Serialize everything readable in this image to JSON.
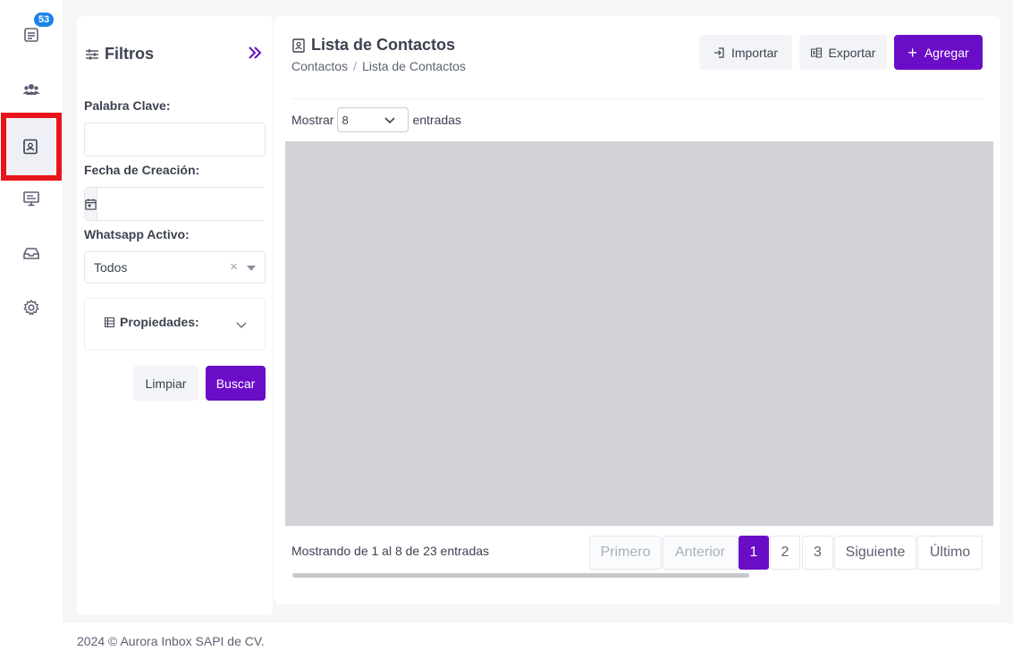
{
  "sidebar": {
    "badge_count": "53",
    "items": [
      {
        "name": "tickets",
        "icon": "ticket-icon"
      },
      {
        "name": "users",
        "icon": "users-icon"
      },
      {
        "name": "contacts",
        "icon": "contact-book-icon",
        "active": true
      },
      {
        "name": "monitor",
        "icon": "monitor-icon"
      },
      {
        "name": "inbox",
        "icon": "inbox-tray-icon"
      },
      {
        "name": "settings",
        "icon": "gear-icon"
      }
    ]
  },
  "filters": {
    "title": "Filtros",
    "keyword_label": "Palabra Clave:",
    "keyword_value": "",
    "date_label": "Fecha de Creación:",
    "date_value": "",
    "whatsapp_label": "Whatsapp Activo:",
    "whatsapp_value": "Todos",
    "clear_symbol": "×",
    "properties_label": "Propiedades:",
    "clear_button": "Limpiar",
    "search_button": "Buscar"
  },
  "header": {
    "title": "Lista de Contactos",
    "breadcrumb": [
      "Contactos",
      "Lista de Contactos"
    ],
    "breadcrumb_sep": "/",
    "import_button": "Importar",
    "export_button": "Exportar",
    "add_button": "Agregar",
    "add_symbol": "+"
  },
  "table": {
    "show_label": "Mostrar",
    "entries_value": "8",
    "entries_label": "entradas",
    "showing_text": "Mostrando de 1 al 8 de 23 entradas"
  },
  "pagination": {
    "first": "Primero",
    "previous": "Anterior",
    "pages": [
      "1",
      "2",
      "3"
    ],
    "current_page": "1",
    "next": "Siguiente",
    "last": "Último"
  },
  "footer": {
    "text": "2024 © Aurora Inbox SAPI de CV."
  },
  "colors": {
    "primary": "#6a0dc6",
    "badge": "#1b84e7",
    "highlight": "#e8141c",
    "placeholder": "#d1d3d6"
  }
}
